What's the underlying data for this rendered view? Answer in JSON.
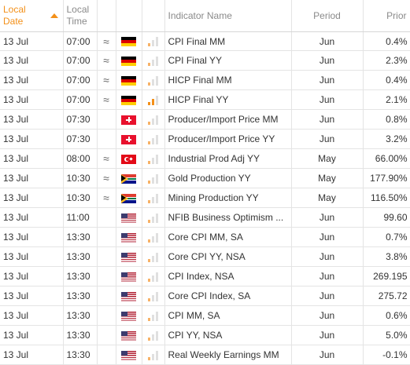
{
  "headers": {
    "local_date": "Local Date",
    "local_time": "Local Time",
    "indicator": "Indicator Name",
    "period": "Period",
    "prior": "Prior"
  },
  "colors": {
    "accent": "#f39019",
    "header_text": "#8a8a8a",
    "grid": "#e4e4e4"
  },
  "rows": [
    {
      "date": "13 Jul",
      "time": "07:00",
      "volatility": "≈",
      "country": "DE",
      "importance": 1,
      "indicator": "CPI Final MM",
      "period": "Jun",
      "prior": "0.4%"
    },
    {
      "date": "13 Jul",
      "time": "07:00",
      "volatility": "≈",
      "country": "DE",
      "importance": 1,
      "indicator": "CPI Final YY",
      "period": "Jun",
      "prior": "2.3%"
    },
    {
      "date": "13 Jul",
      "time": "07:00",
      "volatility": "≈",
      "country": "DE",
      "importance": 1,
      "indicator": "HICP Final MM",
      "period": "Jun",
      "prior": "0.4%"
    },
    {
      "date": "13 Jul",
      "time": "07:00",
      "volatility": "≈",
      "country": "DE",
      "importance": 2,
      "indicator": "HICP Final YY",
      "period": "Jun",
      "prior": "2.1%"
    },
    {
      "date": "13 Jul",
      "time": "07:30",
      "volatility": "",
      "country": "CH",
      "importance": 1,
      "indicator": "Producer/Import Price MM",
      "period": "Jun",
      "prior": "0.8%"
    },
    {
      "date": "13 Jul",
      "time": "07:30",
      "volatility": "",
      "country": "CH",
      "importance": 1,
      "indicator": "Producer/Import Price YY",
      "period": "Jun",
      "prior": "3.2%"
    },
    {
      "date": "13 Jul",
      "time": "08:00",
      "volatility": "≈",
      "country": "TR",
      "importance": 1,
      "indicator": "Industrial Prod Adj YY",
      "period": "May",
      "prior": "66.00%"
    },
    {
      "date": "13 Jul",
      "time": "10:30",
      "volatility": "≈",
      "country": "ZA",
      "importance": 1,
      "indicator": "Gold Production YY",
      "period": "May",
      "prior": "177.90%"
    },
    {
      "date": "13 Jul",
      "time": "10:30",
      "volatility": "≈",
      "country": "ZA",
      "importance": 1,
      "indicator": "Mining Production YY",
      "period": "May",
      "prior": "116.50%"
    },
    {
      "date": "13 Jul",
      "time": "11:00",
      "volatility": "",
      "country": "US",
      "importance": 1,
      "indicator": "NFIB Business Optimism ...",
      "period": "Jun",
      "prior": "99.60"
    },
    {
      "date": "13 Jul",
      "time": "13:30",
      "volatility": "",
      "country": "US",
      "importance": 1,
      "indicator": "Core CPI MM, SA",
      "period": "Jun",
      "prior": "0.7%"
    },
    {
      "date": "13 Jul",
      "time": "13:30",
      "volatility": "",
      "country": "US",
      "importance": 1,
      "indicator": "Core CPI YY, NSA",
      "period": "Jun",
      "prior": "3.8%"
    },
    {
      "date": "13 Jul",
      "time": "13:30",
      "volatility": "",
      "country": "US",
      "importance": 1,
      "indicator": "CPI Index, NSA",
      "period": "Jun",
      "prior": "269.195"
    },
    {
      "date": "13 Jul",
      "time": "13:30",
      "volatility": "",
      "country": "US",
      "importance": 1,
      "indicator": "Core CPI Index, SA",
      "period": "Jun",
      "prior": "275.72"
    },
    {
      "date": "13 Jul",
      "time": "13:30",
      "volatility": "",
      "country": "US",
      "importance": 1,
      "indicator": "CPI MM, SA",
      "period": "Jun",
      "prior": "0.6%"
    },
    {
      "date": "13 Jul",
      "time": "13:30",
      "volatility": "",
      "country": "US",
      "importance": 1,
      "indicator": "CPI YY, NSA",
      "period": "Jun",
      "prior": "5.0%"
    },
    {
      "date": "13 Jul",
      "time": "13:30",
      "volatility": "",
      "country": "US",
      "importance": 1,
      "indicator": "Real Weekly Earnings MM",
      "period": "Jun",
      "prior": "-0.1%"
    }
  ]
}
